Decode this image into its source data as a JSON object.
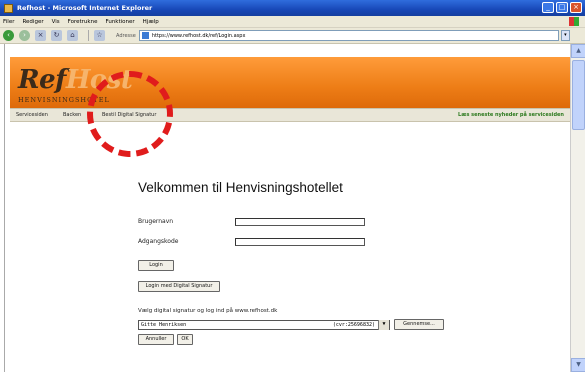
{
  "window": {
    "title": "Refhost - Microsoft Internet Explorer",
    "buttons": [
      "_",
      "□",
      "×"
    ]
  },
  "menu": [
    "Filer",
    "Rediger",
    "Vis",
    "Foretrukne",
    "Funktioner",
    "Hjælp"
  ],
  "toolbar": {
    "address_label": "Adresse",
    "url": "https://www.refhost.dk/ref/Login.aspx"
  },
  "site": {
    "logo_dark": "Ref",
    "logo_light": "Host",
    "logo_sub": "HENVISNINGSHOTEL",
    "nav": [
      "Servicesiden",
      "Backen",
      "Bestil Digital Signatur"
    ],
    "news_link": "Læs seneste nyheder på servicesiden"
  },
  "login": {
    "heading": "Velkommen til Henvisningshotellet",
    "username_label": "Brugernavn",
    "password_label": "Adgangskode",
    "login_button": "Login",
    "digital_login_button": "Login med Digital Signatur",
    "signature_prompt": "Vælg digital signatur og log ind på www.refhost.dk",
    "selected_signature": "Gitte Henriksen",
    "signature_cvr": "(cvr:25696832)",
    "browse_button": "Gennemse...",
    "cancel_button": "Annuller",
    "ok_button": "OK"
  },
  "colors": {
    "banner": "#ed7d16",
    "annotation": "#e01c1c",
    "news": "#2d7a1f"
  }
}
